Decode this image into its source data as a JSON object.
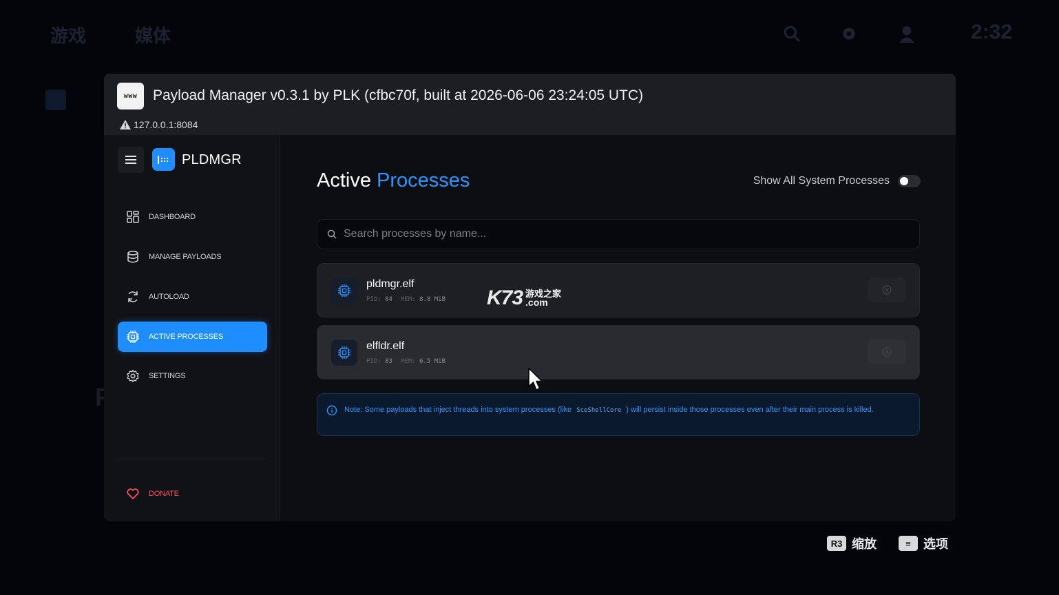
{
  "ps_topbar": {
    "tabs": [
      "游戏",
      "媒体"
    ],
    "time": "2:32",
    "icons": [
      "search-icon",
      "gear-icon",
      "user-icon"
    ]
  },
  "browser": {
    "icon_label": "www",
    "title": "Payload Manager v0.3.1 by PLK (cfbc70f, built at 2026-06-06 23:24:05 UTC)",
    "url": "127.0.0.1:8084"
  },
  "app": {
    "name": "PLDMGR",
    "nav": [
      {
        "label": "DASHBOARD",
        "icon": "dashboard-icon"
      },
      {
        "label": "MANAGE PAYLOADS",
        "icon": "database-icon"
      },
      {
        "label": "AUTOLOAD",
        "icon": "refresh-icon"
      },
      {
        "label": "ACTIVE PROCESSES",
        "icon": "cpu-icon",
        "active": true
      },
      {
        "label": "SETTINGS",
        "icon": "gear-icon"
      }
    ],
    "donate_label": "DONATE"
  },
  "main": {
    "title_plain": "Active",
    "title_accent": "Processes",
    "toggle_label": "Show All System Processes",
    "toggle_on": false,
    "search_placeholder": "Search processes by name...",
    "pid_label": "PID:",
    "mem_label": "MEM:",
    "processes": [
      {
        "name": "pldmgr.elf",
        "pid": "84",
        "mem": "8.8 MiB"
      },
      {
        "name": "elfldr.elf",
        "pid": "83",
        "mem": "6.5 MiB"
      }
    ],
    "note_before": "Note: Some payloads that inject threads into system processes (like",
    "note_code": "SceShellCore",
    "note_after": ") will persist inside those processes even after their main process is killed."
  },
  "watermark": {
    "brand": "K73",
    "cn": "游戏之家",
    "domain": ".com"
  },
  "hints": [
    {
      "key": "R3",
      "label": "缩放"
    },
    {
      "key": "≡",
      "label": "选项"
    }
  ],
  "colors": {
    "accent": "#1e8dff",
    "danger": "#ff4d5e",
    "note_text": "#2f95ff"
  }
}
